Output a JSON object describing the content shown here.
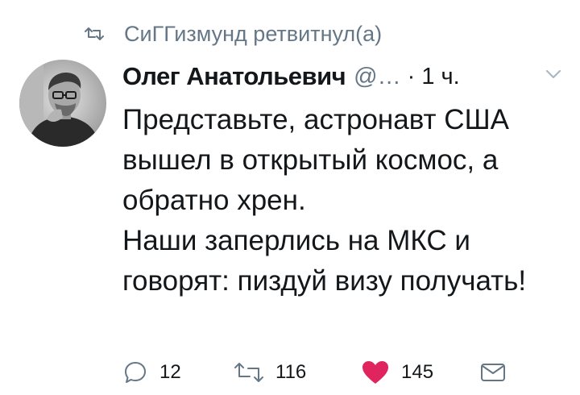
{
  "retweet_banner": {
    "icon": "retweet-icon",
    "text": "СиГГизмунд ретвитнул(а)"
  },
  "tweet": {
    "author_name": "Олег Анатольевич",
    "handle": "@…",
    "time": "· 1 ч.",
    "caret_icon": "chevron-down-icon",
    "paragraphs": [
      "Представьте, астронавт США вышел в открытый космос, а обратно хрен.",
      "Наши заперлись на МКС и говорят: пиздуй визу получать!"
    ]
  },
  "actions": {
    "reply": {
      "icon": "reply-icon",
      "count": "12"
    },
    "retweet": {
      "icon": "retweet-icon",
      "count": "116"
    },
    "like": {
      "icon": "heart-icon",
      "count": "145",
      "active": true,
      "color": "#e0245e"
    },
    "message": {
      "icon": "envelope-icon"
    }
  },
  "colors": {
    "secondary_text": "#657786",
    "primary_text": "#14171a",
    "like_active": "#e0245e"
  }
}
